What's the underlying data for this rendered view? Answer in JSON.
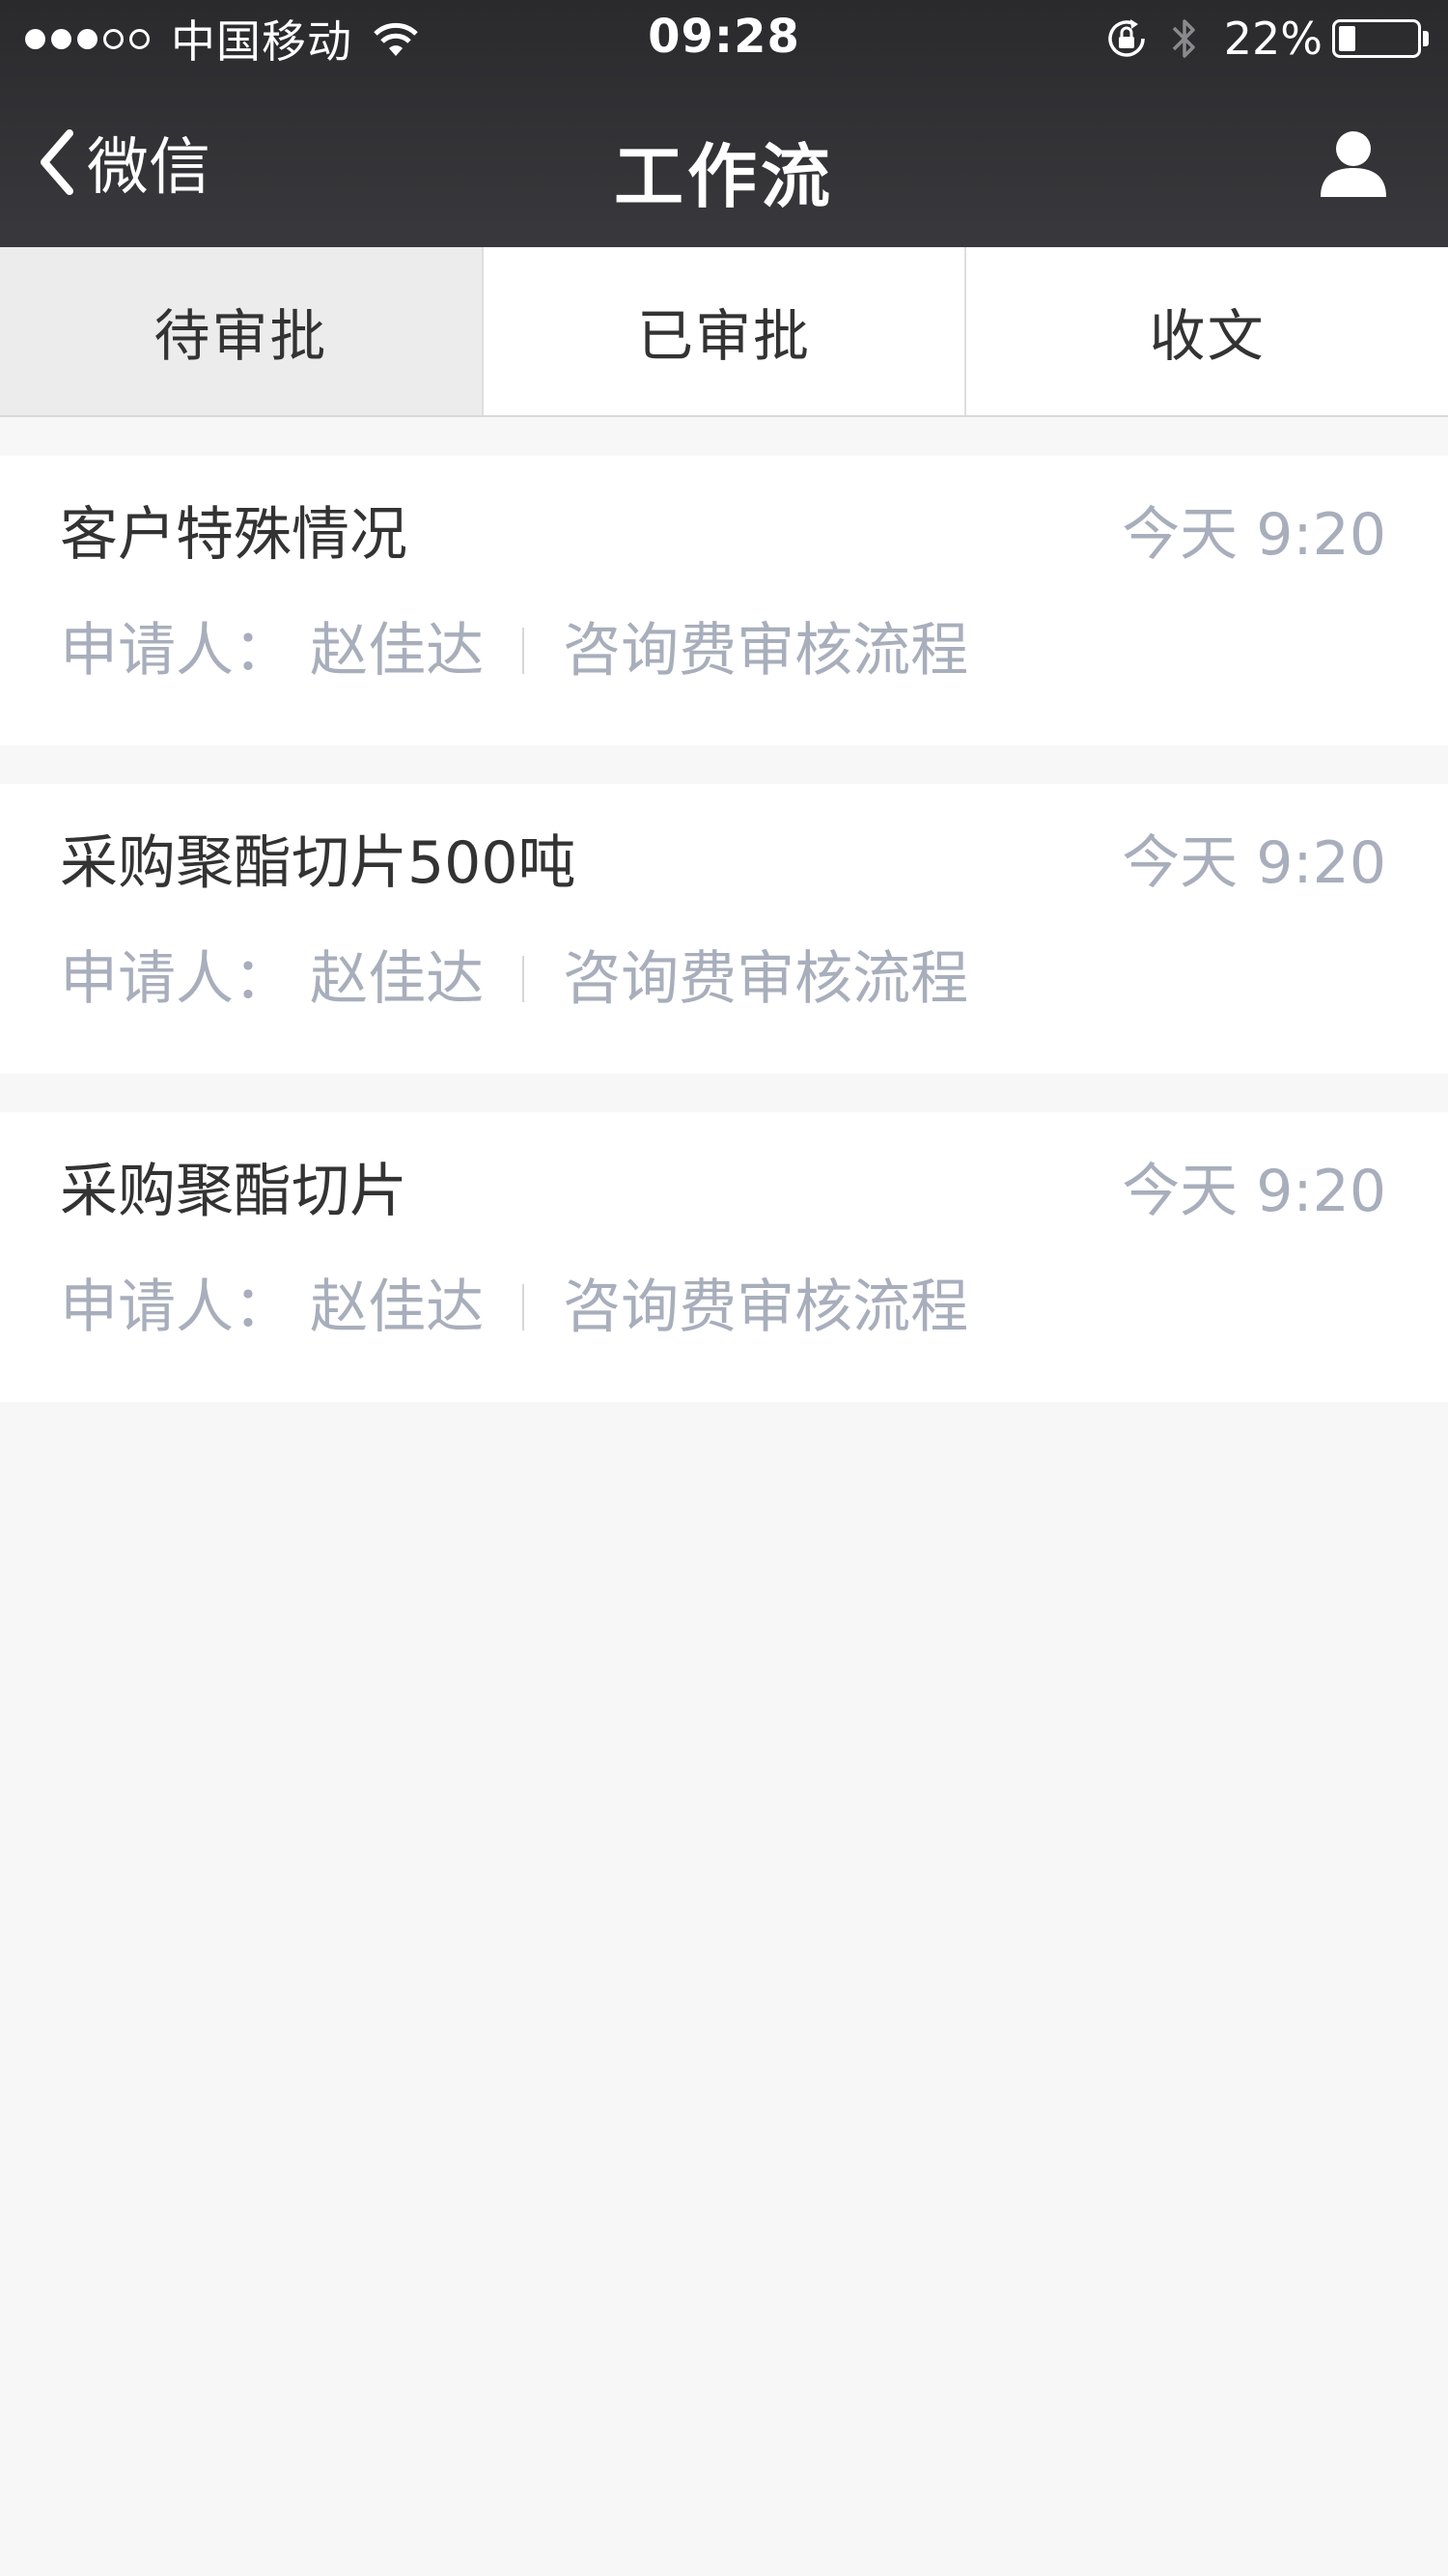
{
  "status_bar": {
    "carrier": "中国移动",
    "time": "09:28",
    "battery_percent": "22%",
    "battery_level": 0.22,
    "signal_bars_filled": 3,
    "signal_bars_total": 5
  },
  "nav": {
    "back_label": "微信",
    "title": "工作流"
  },
  "tabs": [
    {
      "label": "待审批",
      "active": true
    },
    {
      "label": "已审批",
      "active": false
    },
    {
      "label": "收文",
      "active": false
    }
  ],
  "items": [
    {
      "title": "客户特殊情况",
      "time": "今天 9:20",
      "applicant": "申请人：  赵佳达",
      "process": "咨询费审核流程"
    },
    {
      "title": "采购聚酯切片500吨",
      "time": "今天 9:20",
      "applicant": "申请人：  赵佳达",
      "process": "咨询费审核流程"
    },
    {
      "title": "采购聚酯切片",
      "time": "今天 9:20",
      "applicant": "申请人：  赵佳达",
      "process": "咨询费审核流程"
    }
  ],
  "icons": {
    "back": "chevron-left-icon",
    "profile": "person-icon",
    "wifi": "wifi-icon",
    "orientation_lock": "orientation-lock-icon",
    "bluetooth": "bluetooth-icon",
    "battery": "battery-icon"
  },
  "colors": {
    "nav_background": "#333336",
    "page_background": "#f7f7f7",
    "active_tab": "#ececec",
    "secondary_text": "#a8aebb",
    "primary_text": "#333333"
  }
}
